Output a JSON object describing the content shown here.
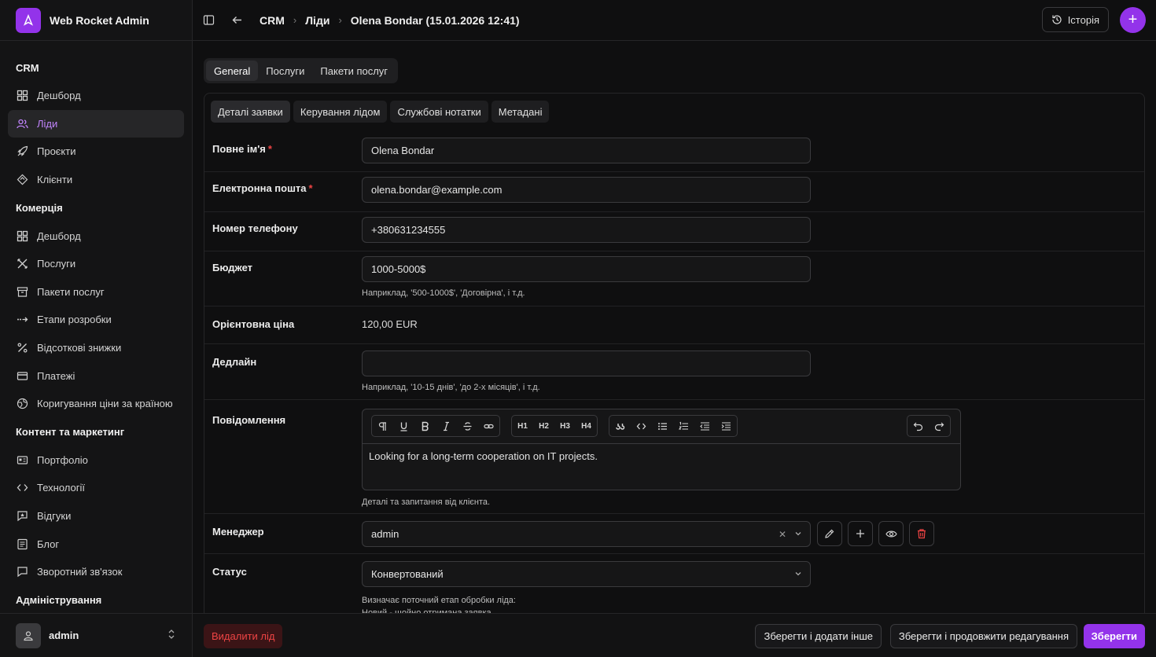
{
  "app": {
    "name": "Web Rocket Admin",
    "logo_letter": "A"
  },
  "breadcrumb": {
    "items": [
      "CRM",
      "Ліди",
      "Olena Bondar (15.01.2026 12:41)"
    ]
  },
  "header": {
    "history_label": "Історія",
    "add_label": "+"
  },
  "sidebar": {
    "groups": [
      {
        "title": "CRM",
        "items": [
          {
            "label": "Дешборд",
            "icon": "dashboard-icon"
          },
          {
            "label": "Ліди",
            "icon": "users-icon",
            "active": true
          },
          {
            "label": "Проєкти",
            "icon": "rocket-icon"
          },
          {
            "label": "Клієнти",
            "icon": "handshake-icon"
          }
        ]
      },
      {
        "title": "Комерція",
        "items": [
          {
            "label": "Дешборд",
            "icon": "dashboard-icon"
          },
          {
            "label": "Послуги",
            "icon": "tools-icon"
          },
          {
            "label": "Пакети послуг",
            "icon": "archive-icon"
          },
          {
            "label": "Етапи розробки",
            "icon": "steps-icon"
          },
          {
            "label": "Відсоткові знижки",
            "icon": "percent-icon"
          },
          {
            "label": "Платежі",
            "icon": "credit-card-icon"
          },
          {
            "label": "Коригування ціни за країною",
            "icon": "globe-icon"
          }
        ]
      },
      {
        "title": "Контент та маркетинг",
        "items": [
          {
            "label": "Портфоліо",
            "icon": "portfolio-icon"
          },
          {
            "label": "Технології",
            "icon": "code-icon"
          },
          {
            "label": "Відгуки",
            "icon": "review-icon"
          },
          {
            "label": "Блог",
            "icon": "blog-icon"
          },
          {
            "label": "Зворотний зв'язок",
            "icon": "feedback-icon"
          }
        ]
      },
      {
        "title": "Адміністрування",
        "items": []
      }
    ],
    "user": {
      "name": "admin"
    }
  },
  "tabs": {
    "top": [
      "General",
      "Послуги",
      "Пакети послуг"
    ],
    "sub": [
      "Деталі заявки",
      "Керування лідом",
      "Службові нотатки",
      "Метадані"
    ]
  },
  "form": {
    "full_name": {
      "label": "Повне ім'я",
      "required": "*",
      "value": "Olena Bondar"
    },
    "email": {
      "label": "Електронна пошта",
      "required": "*",
      "value": "olena.bondar@example.com"
    },
    "phone": {
      "label": "Номер телефону",
      "value": "+380631234555"
    },
    "budget": {
      "label": "Бюджет",
      "value": "1000-5000$",
      "hint": "Наприклад, '500-1000$', 'Договірна', і т.д."
    },
    "price": {
      "label": "Орієнтовна ціна",
      "value": "120,00 EUR"
    },
    "deadline": {
      "label": "Дедлайн",
      "value": "",
      "hint": "Наприклад, '10-15 днів', 'до 2-х місяців', і т.д."
    },
    "message": {
      "label": "Повідомлення",
      "value": "Looking for a long-term cooperation on IT projects.",
      "hint": "Деталі та запитання від клієнта.",
      "toolbar": {
        "h1": "H1",
        "h2": "H2",
        "h3": "H3",
        "h4": "H4"
      }
    },
    "manager": {
      "label": "Менеджер",
      "value": "admin"
    },
    "status": {
      "label": "Статус",
      "value": "Конвертований",
      "hint1": "Визначає поточний етап обробки ліда:",
      "hint2": "Новий - щойно отримана заявка"
    }
  },
  "footer": {
    "delete": "Видалити лід",
    "save_add": "Зберегти і додати інше",
    "save_continue": "Зберегти і продовжити редагування",
    "save": "Зберегти"
  },
  "colors": {
    "accent": "#9333ea",
    "danger": "#ef4444",
    "bg": "#0f0f10"
  }
}
